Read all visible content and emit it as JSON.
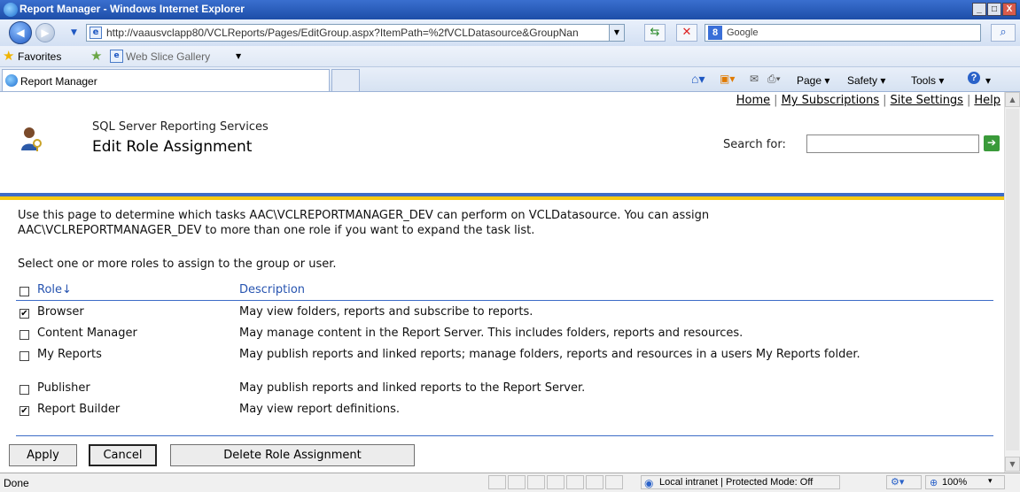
{
  "window": {
    "title": "Report Manager - Windows Internet Explorer",
    "min": "_",
    "max": "□",
    "close": "X"
  },
  "nav": {
    "url": "http://vaausvclapp80/VCLReports/Pages/EditGroup.aspx?ItemPath=%2fVCLDatasource&GroupNan",
    "search_placeholder": "Google",
    "back_glyph": "◀",
    "forward_glyph": "▶"
  },
  "favorites": {
    "label": "Favorites",
    "web_slice": "Web Slice Gallery"
  },
  "tab": {
    "label": "Report Manager"
  },
  "commands": {
    "page": "Page",
    "safety": "Safety",
    "tools": "Tools"
  },
  "content": {
    "top_links": [
      "Home",
      "My Subscriptions",
      "Site Settings",
      "Help"
    ],
    "product": "SQL Server Reporting Services",
    "page_title": "Edit Role Assignment",
    "search_label": "Search for:",
    "description_line1": "Use this page to determine which tasks AAC\\VCLREPORTMANAGER_DEV can perform on VCLDatasource. You can assign",
    "description_line2": "AAC\\VCLREPORTMANAGER_DEV to more than one role if you want to expand the task list.",
    "instruction": "Select one or more roles to assign to the group or user.",
    "headers": {
      "role": "Role↓",
      "description": "Description"
    },
    "roles": [
      {
        "name": "Browser",
        "checked": true,
        "desc": "May view folders, reports and subscribe to reports."
      },
      {
        "name": "Content Manager",
        "checked": false,
        "desc": "May manage content in the Report Server.  This includes folders, reports and resources."
      },
      {
        "name": "My Reports",
        "checked": false,
        "desc": "May publish reports and linked reports; manage folders, reports and resources in a users My Reports folder."
      },
      {
        "name": "Publisher",
        "checked": false,
        "desc": "May publish reports and linked reports to the Report Server."
      },
      {
        "name": "Report Builder",
        "checked": true,
        "desc": "May view report definitions."
      }
    ],
    "buttons": {
      "apply": "Apply",
      "cancel": "Cancel",
      "delete": "Delete Role Assignment"
    }
  },
  "status": {
    "text": "Done",
    "zone": "Local intranet | Protected Mode: Off",
    "zoom": "100%"
  },
  "colors": {
    "accent_blue": "#3d6cc7",
    "accent_yellow": "#f6c913",
    "link_blue": "#2754b0"
  }
}
